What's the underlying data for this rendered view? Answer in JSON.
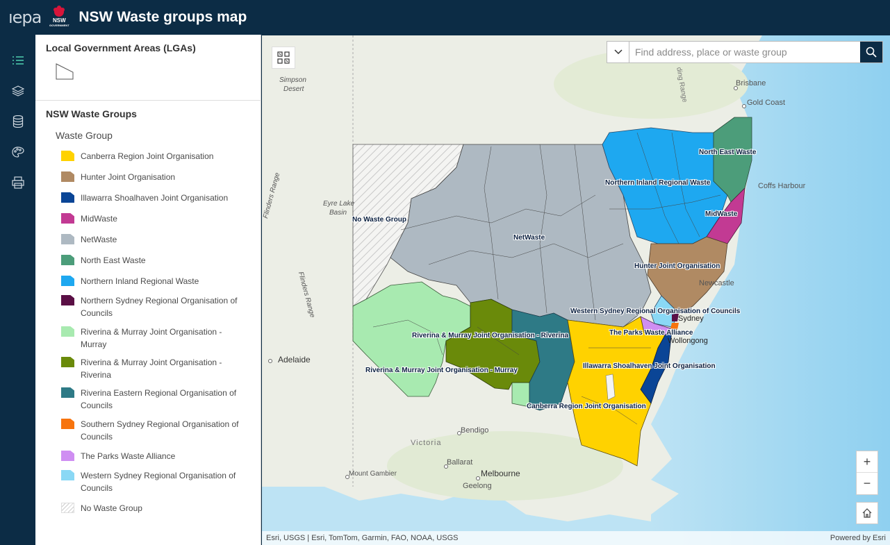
{
  "header": {
    "epa_logo": "ıepa",
    "nsw_logo": "NSW",
    "nsw_sub": "GOVERNMENT",
    "title": "NSW Waste groups map"
  },
  "rail": {
    "icons": [
      "legend-list-icon",
      "layers-icon",
      "basemap-database-icon",
      "basemap-palette-icon",
      "print-icon"
    ]
  },
  "legend": {
    "lga_title": "Local Government Areas (LGAs)",
    "waste_groups_title": "NSW Waste Groups",
    "waste_group_subtitle": "Waste Group",
    "items": [
      {
        "label": "Canberra Region Joint Organisation",
        "color": "#ffd200"
      },
      {
        "label": "Hunter Joint Organisation",
        "color": "#b08a63"
      },
      {
        "label": "Illawarra Shoalhaven Joint Organisation",
        "color": "#0a4596"
      },
      {
        "label": "MidWaste",
        "color": "#c23a93"
      },
      {
        "label": "NetWaste",
        "color": "#aeb9c2"
      },
      {
        "label": "North East Waste",
        "color": "#4c9d7a"
      },
      {
        "label": "Northern Inland Regional Waste",
        "color": "#1ea8f0"
      },
      {
        "label": "Northern Sydney Regional Organisation of Councils",
        "color": "#5a0f45"
      },
      {
        "label": "Riverina & Murray Joint Organisation - Murray",
        "color": "#a8eab0"
      },
      {
        "label": "Riverina & Murray Joint Organisation - Riverina",
        "color": "#6a8a0a"
      },
      {
        "label": "Riverina Eastern Regional Organisation of Councils",
        "color": "#2e7a86"
      },
      {
        "label": "Southern Sydney Regional Organisation of Councils",
        "color": "#f7740e"
      },
      {
        "label": "The Parks Waste Alliance",
        "color": "#cf8ef2"
      },
      {
        "label": "Western Sydney Regional Organisation of Councils",
        "color": "#8ad8f5"
      },
      {
        "label": "No Waste Group",
        "color": "hatch"
      }
    ]
  },
  "map": {
    "search_placeholder": "Find address, place or waste group",
    "zoom_in": "+",
    "zoom_out": "−",
    "attribution": "Esri, USGS | Esri, TomTom, Garmin, FAO, NOAA, USGS",
    "powered_by": "Powered by Esri",
    "place_labels": {
      "simpson": "Simpson",
      "desert": "Desert",
      "eyre1": "Eyre Lake",
      "eyre2": "Basin",
      "flinders1": "Flinders Range",
      "flinders2": "Flinders Range",
      "ding_range": "ding Range",
      "brisbane": "Brisbane",
      "gold_coast": "Gold Coast",
      "coffs": "Coffs Harbour",
      "newcastle": "Newcastle",
      "sydney": "Sydney",
      "wollongong": "Wollongong",
      "adelaide": "Adelaide",
      "bendigo": "Bendigo",
      "victoria": "Victoria",
      "ballarat": "Ballarat",
      "melbourne": "Melbourne",
      "geelong": "Geelong",
      "mount_gambier": "Mount Gambier"
    },
    "group_labels": {
      "north_east": "North East Waste",
      "northern_inland": "Northern Inland Regional Waste",
      "midwaste": "MidWaste",
      "no_group": "No Waste Group",
      "netwaste": "NetWaste",
      "hunter": "Hunter Joint Organisation",
      "western_sydney": "Western Sydney Regional Organisation of Councils",
      "parks": "The Parks Waste Alliance",
      "riverina": "Riverina & Murray Joint Organisation - Riverina",
      "murray": "Riverina & Murray Joint Organisation - Murray",
      "illawarra": "Illawarra Shoalhaven Joint Organisation",
      "canberra": "Canberra Region Joint Organisation"
    }
  }
}
